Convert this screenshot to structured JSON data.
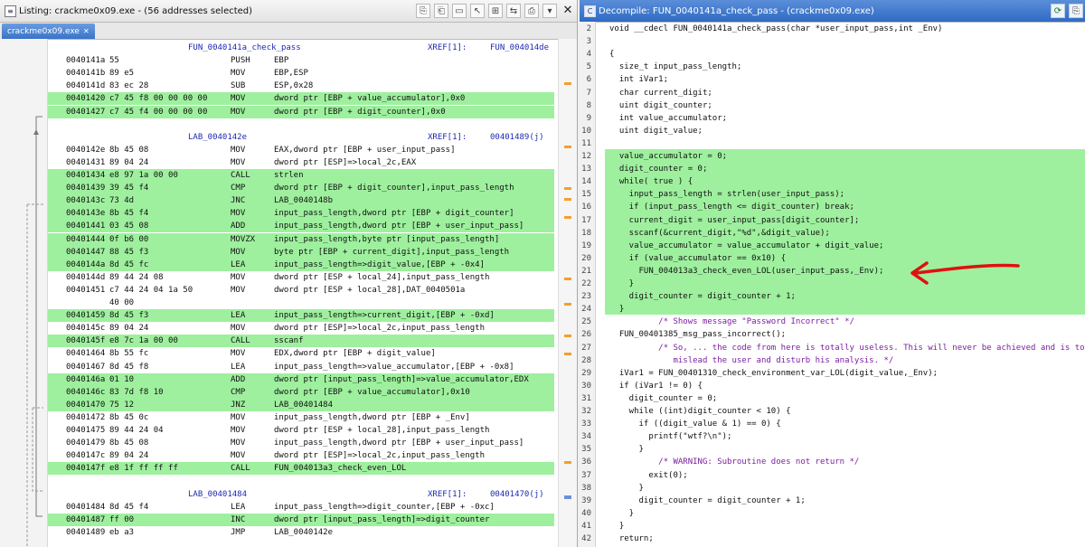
{
  "listing": {
    "title": "Listing:  crackme0x09.exe - (56 addresses selected)",
    "tab_label": "crackme0x09.exe",
    "rows": [
      {
        "kind": "func",
        "label": "FUN_0040141a_check_pass",
        "xref": "XREF[1]:",
        "xref_to": "FUN_004014de"
      },
      {
        "kind": "ins",
        "addr": "0040141a",
        "bytes": "55",
        "mn": "PUSH",
        "op": "EBP",
        "hl": false
      },
      {
        "kind": "ins",
        "addr": "0040141b",
        "bytes": "89 e5",
        "mn": "MOV",
        "op": "EBP,ESP",
        "hl": false
      },
      {
        "kind": "ins",
        "addr": "0040141d",
        "bytes": "83 ec 28",
        "mn": "SUB",
        "op": "ESP,0x28",
        "hl": false
      },
      {
        "kind": "ins",
        "addr": "00401420",
        "bytes": "c7 45 f8 00 00 00 00",
        "mn": "MOV",
        "op": "dword ptr [EBP + value_accumulator],0x0",
        "hl": true
      },
      {
        "kind": "ins",
        "addr": "00401427",
        "bytes": "c7 45 f4 00 00 00 00",
        "mn": "MOV",
        "op": "dword ptr [EBP + digit_counter],0x0",
        "hl": true
      },
      {
        "kind": "blank"
      },
      {
        "kind": "label",
        "label": "LAB_0040142e",
        "xref": "XREF[1]:",
        "xref_to": "00401489(j)"
      },
      {
        "kind": "ins",
        "addr": "0040142e",
        "bytes": "8b 45 08",
        "mn": "MOV",
        "op": "EAX,dword ptr [EBP + user_input_pass]",
        "hl": false
      },
      {
        "kind": "ins",
        "addr": "00401431",
        "bytes": "89 04 24",
        "mn": "MOV",
        "op": "dword ptr [ESP]=>local_2c,EAX",
        "hl": false
      },
      {
        "kind": "ins",
        "addr": "00401434",
        "bytes": "e8 97 1a 00 00",
        "mn": "CALL",
        "op": "strlen",
        "hl": true
      },
      {
        "kind": "ins",
        "addr": "00401439",
        "bytes": "39 45 f4",
        "mn": "CMP",
        "op": "dword ptr [EBP + digit_counter],input_pass_length",
        "hl": true
      },
      {
        "kind": "ins",
        "addr": "0040143c",
        "bytes": "73 4d",
        "mn": "JNC",
        "op": "LAB_0040148b",
        "hl": true
      },
      {
        "kind": "ins",
        "addr": "0040143e",
        "bytes": "8b 45 f4",
        "mn": "MOV",
        "op": "input_pass_length,dword ptr [EBP + digit_counter]",
        "hl": true
      },
      {
        "kind": "ins",
        "addr": "00401441",
        "bytes": "03 45 08",
        "mn": "ADD",
        "op": "input_pass_length,dword ptr [EBP + user_input_pass]",
        "hl": true
      },
      {
        "kind": "ins",
        "addr": "00401444",
        "bytes": "0f b6 00",
        "mn": "MOVZX",
        "op": "input_pass_length,byte ptr [input_pass_length]",
        "hl": true
      },
      {
        "kind": "ins",
        "addr": "00401447",
        "bytes": "88 45 f3",
        "mn": "MOV",
        "op": "byte ptr [EBP + current_digit],input_pass_length",
        "hl": true
      },
      {
        "kind": "ins",
        "addr": "0040144a",
        "bytes": "8d 45 fc",
        "mn": "LEA",
        "op": "input_pass_length=>digit_value,[EBP + -0x4]",
        "hl": true
      },
      {
        "kind": "ins",
        "addr": "0040144d",
        "bytes": "89 44 24 08",
        "mn": "MOV",
        "op": "dword ptr [ESP + local_24],input_pass_length",
        "hl": false
      },
      {
        "kind": "ins",
        "addr": "00401451",
        "bytes": "c7 44 24 04 1a 50",
        "mn": "MOV",
        "op": "dword ptr [ESP + local_28],DAT_0040501a",
        "hl": false
      },
      {
        "kind": "cont",
        "bytes": "40 00",
        "hl": false
      },
      {
        "kind": "ins",
        "addr": "00401459",
        "bytes": "8d 45 f3",
        "mn": "LEA",
        "op": "input_pass_length=>current_digit,[EBP + -0xd]",
        "hl": true
      },
      {
        "kind": "ins",
        "addr": "0040145c",
        "bytes": "89 04 24",
        "mn": "MOV",
        "op": "dword ptr [ESP]=>local_2c,input_pass_length",
        "hl": false
      },
      {
        "kind": "ins",
        "addr": "0040145f",
        "bytes": "e8 7c 1a 00 00",
        "mn": "CALL",
        "op": "sscanf",
        "hl": true
      },
      {
        "kind": "ins",
        "addr": "00401464",
        "bytes": "8b 55 fc",
        "mn": "MOV",
        "op": "EDX,dword ptr [EBP + digit_value]",
        "hl": false
      },
      {
        "kind": "ins",
        "addr": "00401467",
        "bdts": "",
        "bytes": "8d 45 f8",
        "mn": "LEA",
        "op": "input_pass_length=>value_accumulator,[EBP + -0x8]",
        "hl": false
      },
      {
        "kind": "ins",
        "addr": "0040146a",
        "bytes": "01 10",
        "mn": "ADD",
        "op": "dword ptr [input_pass_length]=>value_accumulator,EDX",
        "hl": true
      },
      {
        "kind": "ins",
        "addr": "0040146c",
        "bytes": "83 7d f8 10",
        "mn": "CMP",
        "op": "dword ptr [EBP + value_accumulator],0x10",
        "hl": true
      },
      {
        "kind": "ins",
        "addr": "00401470",
        "bytes": "75 12",
        "mn": "JNZ",
        "op": "LAB_00401484",
        "hl": true
      },
      {
        "kind": "ins",
        "addr": "00401472",
        "bytes": "8b 45 0c",
        "mn": "MOV",
        "op": "input_pass_length,dword ptr [EBP + _Env]",
        "hl": false
      },
      {
        "kind": "ins",
        "addr": "00401475",
        "bytes": "89 44 24 04",
        "mn": "MOV",
        "op": "dword ptr [ESP + local_28],input_pass_length",
        "hl": false
      },
      {
        "kind": "ins",
        "addr": "00401479",
        "bytes": "8b 45 08",
        "mn": "MOV",
        "op": "input_pass_length,dword ptr [EBP + user_input_pass]",
        "hl": false
      },
      {
        "kind": "ins",
        "addr": "0040147c",
        "bytes": "89 04 24",
        "mn": "MOV",
        "op": "dword ptr [ESP]=>local_2c,input_pass_length",
        "hl": false
      },
      {
        "kind": "ins",
        "addr": "0040147f",
        "bytes": "e8 1f ff ff ff",
        "mn": "CALL",
        "op": "FUN_004013a3_check_even_LOL",
        "hl": true
      },
      {
        "kind": "blank"
      },
      {
        "kind": "label",
        "label": "LAB_00401484",
        "xref": "XREF[1]:",
        "xref_to": "00401470(j)"
      },
      {
        "kind": "ins",
        "addr": "00401484",
        "bytes": "8d 45 f4",
        "mn": "LEA",
        "op": "input_pass_length=>digit_counter,[EBP + -0xc]",
        "hl": false
      },
      {
        "kind": "ins",
        "addr": "00401487",
        "bytes": "ff 00",
        "mn": "INC",
        "op": "dword ptr [input_pass_length]=>digit_counter",
        "hl": true
      },
      {
        "kind": "ins",
        "addr": "00401489",
        "bytes": "eb a3",
        "mn": "JMP",
        "op": "LAB_0040142e",
        "hl": false
      }
    ]
  },
  "decompile": {
    "title": "Decompile: FUN_0040141a_check_pass - (crackme0x09.exe)",
    "lines": [
      "void __cdecl FUN_0040141a_check_pass(char *user_input_pass,int _Env)",
      "",
      "{",
      "  size_t input_pass_length;",
      "  int iVar1;",
      "  char current_digit;",
      "  uint digit_counter;",
      "  int value_accumulator;",
      "  uint digit_value;",
      "",
      "  value_accumulator = 0;",
      "  digit_counter = 0;",
      "  while( true ) {",
      "    input_pass_length = strlen(user_input_pass);",
      "    if (input_pass_length <= digit_counter) break;",
      "    current_digit = user_input_pass[digit_counter];",
      "    sscanf(&current_digit,\"%d\",&digit_value);",
      "    value_accumulator = value_accumulator + digit_value;",
      "    if (value_accumulator == 0x10) {",
      "      FUN_004013a3_check_even_LOL(user_input_pass,_Env);",
      "    }",
      "    digit_counter = digit_counter + 1;",
      "  }",
      "          /* Shows message \"Password Incorrect\" */",
      "  FUN_00401385_msg_pass_incorrect();",
      "          /* So, ... the code from here is totally useless. This will never be achieved and is to",
      "             mislead the user and disturb his analysis. */",
      "  iVar1 = FUN_00401310_check_environment_var_LOL(digit_value,_Env);",
      "  if (iVar1 != 0) {",
      "    digit_counter = 0;",
      "    while ((int)digit_counter < 10) {",
      "      if ((digit_value & 1) == 0) {",
      "        printf(\"wtf?\\n\");",
      "      }",
      "          /* WARNING: Subroutine does not return */",
      "        exit(0);",
      "      }",
      "      digit_counter = digit_counter + 1;",
      "    }",
      "  }",
      "  return;",
      "}"
    ],
    "line_numbers": [
      "2",
      "3",
      "4",
      "5",
      "6",
      "7",
      "8",
      "9",
      "10",
      "11",
      "12",
      "13",
      "14",
      "15",
      "16",
      "17",
      "18",
      "19",
      "20",
      "21",
      "22",
      "23",
      "24",
      "25",
      "26",
      "27",
      "28",
      "29",
      "30",
      "31",
      "32",
      "33",
      "34",
      "35",
      "36",
      "37",
      "38",
      "39",
      "40",
      "41",
      "42"
    ],
    "annotation_color": "#e01010"
  }
}
